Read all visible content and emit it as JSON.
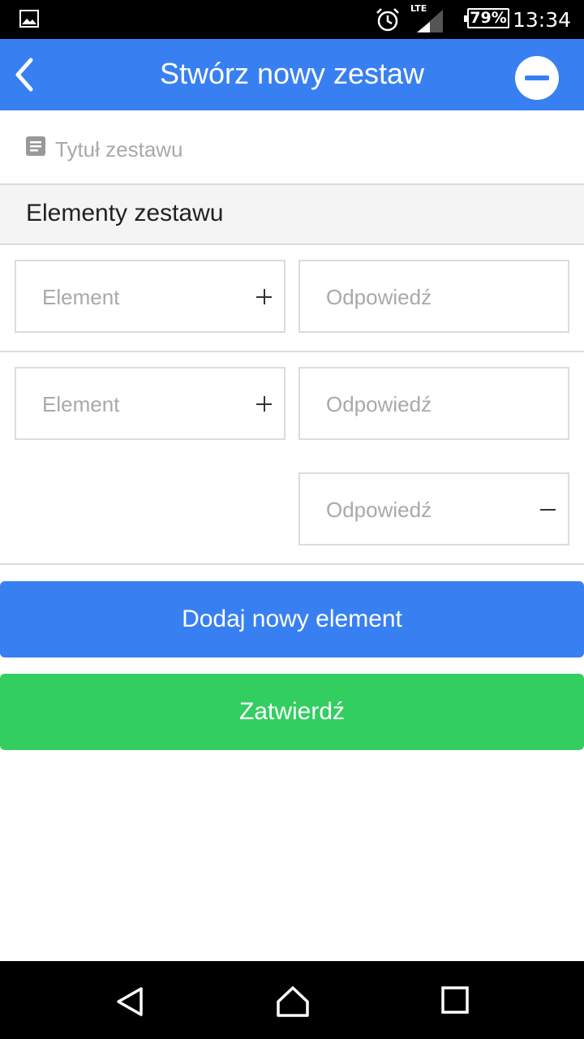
{
  "status_bar": {
    "time": "13:34",
    "battery": "79%",
    "network": "LTE",
    "icons": [
      "image-icon",
      "alarm-icon",
      "signal-icon",
      "battery-icon"
    ]
  },
  "app_bar": {
    "title": "Stwórz nowy zestaw",
    "back_icon": "chevron-left-icon",
    "remove_icon": "minus-circle-icon"
  },
  "set_title": {
    "placeholder": "Tytuł zestawu",
    "value": "",
    "icon": "document-icon"
  },
  "section": {
    "header": "Elementy zestawu"
  },
  "rows": [
    {
      "element_placeholder": "Element",
      "answers": [
        {
          "placeholder": "Odpowiedź",
          "action": "plus"
        }
      ]
    },
    {
      "element_placeholder": "Element",
      "answers": [
        {
          "placeholder": "Odpowiedź",
          "action": "plus"
        },
        {
          "placeholder": "Odpowiedź",
          "action": "minus"
        }
      ]
    }
  ],
  "buttons": {
    "add_element": "Dodaj nowy element",
    "confirm": "Zatwierdź"
  },
  "colors": {
    "primary": "#3880f2",
    "success": "#33ce60",
    "divider": "#dcdcdc",
    "placeholder": "#a9a9a9"
  },
  "nav_bar": {
    "icons": [
      "back-triangle-icon",
      "home-icon",
      "recents-icon"
    ]
  }
}
